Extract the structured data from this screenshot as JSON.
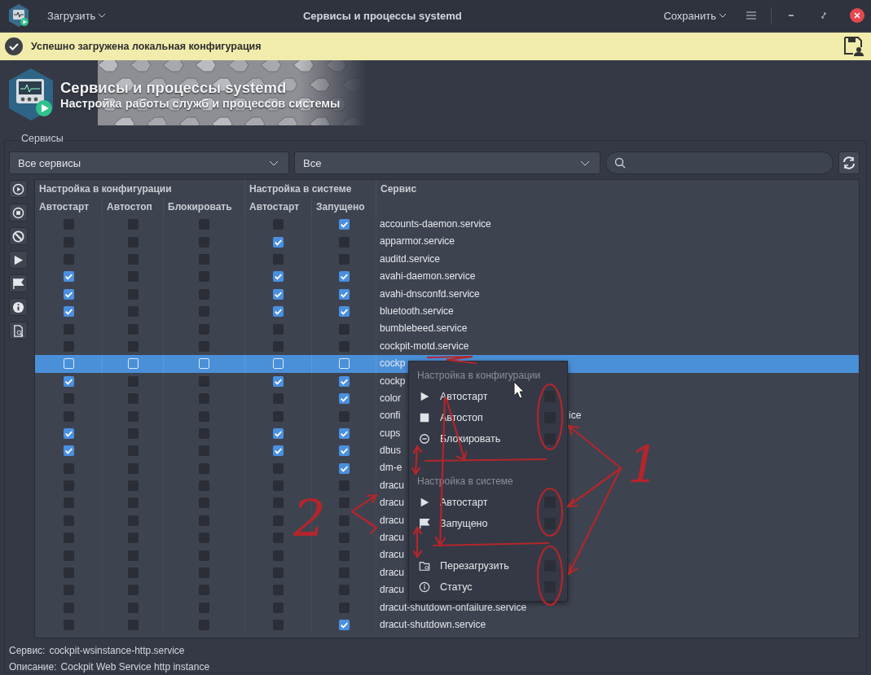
{
  "window": {
    "title": "Сервисы и процессы systemd",
    "load_menu": "Загрузить",
    "save_menu": "Сохранить"
  },
  "notification": {
    "text": "Успешно загружена локальная конфигурация"
  },
  "banner": {
    "title": "Сервисы и процессы systemd",
    "subtitle": "Настройка работы служб и процессов системы"
  },
  "group": {
    "title": "Сервисы"
  },
  "filters": {
    "service_filter": "Все сервисы",
    "state_filter": "Все"
  },
  "table": {
    "groups": [
      "Настройка в конфигурации",
      "Настройка в системе",
      "Сервис"
    ],
    "columns": [
      "Автостарт",
      "Автостоп",
      "Блокировать",
      "Автостарт",
      "Запущено"
    ],
    "rows": [
      {
        "name": "accounts-daemon.service",
        "selected": false,
        "cells": [
          false,
          false,
          false,
          false,
          true
        ]
      },
      {
        "name": "apparmor.service",
        "selected": false,
        "cells": [
          false,
          false,
          false,
          true,
          false
        ]
      },
      {
        "name": "auditd.service",
        "selected": false,
        "cells": [
          false,
          false,
          false,
          false,
          false
        ]
      },
      {
        "name": "avahi-daemon.service",
        "selected": false,
        "cells": [
          true,
          false,
          false,
          true,
          true
        ]
      },
      {
        "name": "avahi-dnsconfd.service",
        "selected": false,
        "cells": [
          true,
          false,
          false,
          true,
          true
        ]
      },
      {
        "name": "bluetooth.service",
        "selected": false,
        "cells": [
          true,
          false,
          false,
          true,
          true
        ]
      },
      {
        "name": "bumblebeed.service",
        "selected": false,
        "cells": [
          false,
          false,
          false,
          false,
          false
        ]
      },
      {
        "name": "cockpit-motd.service",
        "selected": false,
        "cells": [
          false,
          false,
          false,
          false,
          false
        ]
      },
      {
        "name": "cockp",
        "selected": true,
        "cells": [
          false,
          false,
          false,
          false,
          false
        ]
      },
      {
        "name": "cockp",
        "selected": false,
        "cells": [
          true,
          false,
          false,
          true,
          true
        ]
      },
      {
        "name": "color",
        "selected": false,
        "cells": [
          false,
          false,
          false,
          false,
          true
        ]
      },
      {
        "name": "confi",
        "tail": "ice",
        "selected": false,
        "cells": [
          false,
          false,
          false,
          false,
          false
        ]
      },
      {
        "name": "cups",
        "selected": false,
        "cells": [
          true,
          false,
          false,
          true,
          true
        ]
      },
      {
        "name": "dbus",
        "selected": false,
        "cells": [
          true,
          false,
          false,
          true,
          true
        ]
      },
      {
        "name": "dm-e",
        "selected": false,
        "cells": [
          false,
          false,
          false,
          false,
          true
        ]
      },
      {
        "name": "dracu",
        "selected": false,
        "cells": [
          false,
          false,
          false,
          false,
          false
        ]
      },
      {
        "name": "dracu",
        "selected": false,
        "cells": [
          false,
          false,
          false,
          false,
          false
        ]
      },
      {
        "name": "dracu",
        "selected": false,
        "cells": [
          false,
          false,
          false,
          false,
          false
        ]
      },
      {
        "name": "dracu",
        "selected": false,
        "cells": [
          false,
          false,
          false,
          false,
          false
        ]
      },
      {
        "name": "dracu",
        "selected": false,
        "cells": [
          false,
          false,
          false,
          false,
          false
        ]
      },
      {
        "name": "dracu",
        "selected": false,
        "cells": [
          false,
          false,
          false,
          false,
          false
        ]
      },
      {
        "name": "dracu",
        "selected": false,
        "cells": [
          false,
          false,
          false,
          false,
          false
        ]
      },
      {
        "name": "dracut-shutdown-onfailure.service",
        "selected": false,
        "cells": [
          false,
          false,
          false,
          false,
          false
        ]
      },
      {
        "name": "dracut-shutdown.service",
        "selected": false,
        "cells": [
          false,
          false,
          false,
          false,
          true
        ]
      }
    ]
  },
  "context_menu": {
    "items": [
      {
        "kind": "header",
        "label": "Настройка в конфигурации"
      },
      {
        "kind": "item",
        "label": "Автостарт",
        "checked": false
      },
      {
        "kind": "item",
        "label": "Автостоп",
        "checked": false
      },
      {
        "kind": "item",
        "label": "Блокировать",
        "checked": false
      },
      {
        "kind": "separator"
      },
      {
        "kind": "header",
        "label": "Настройка в системе"
      },
      {
        "kind": "item",
        "label": "Автостарт",
        "checked": false
      },
      {
        "kind": "item",
        "label": "Запущено",
        "checked": false
      },
      {
        "kind": "separator"
      },
      {
        "kind": "item",
        "label": "Перезагрузить",
        "checked": false
      },
      {
        "kind": "item",
        "label": "Статус",
        "checked": false
      }
    ]
  },
  "details": {
    "service_label": "Сервис:",
    "service": "cockpit-wsinstance-http.service",
    "description_label": "Описание:",
    "description": "Cockpit Web Service http instance"
  },
  "annotations": [
    "1",
    "2"
  ]
}
